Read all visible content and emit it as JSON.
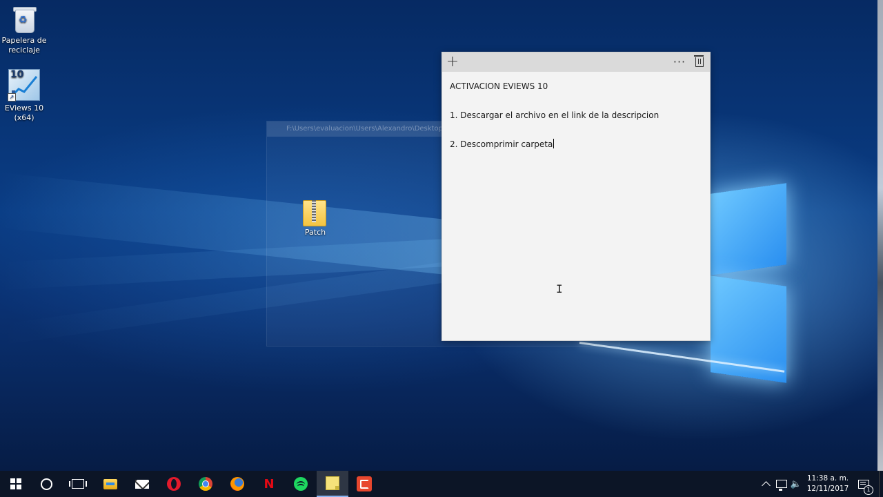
{
  "desktop": {
    "icons": [
      {
        "label": "Papelera de reciclaje",
        "icon": "recycle-bin-icon"
      },
      {
        "label": "EViews 10 (x64)",
        "badge": "10",
        "icon": "eviews-icon"
      },
      {
        "label": "Patch",
        "icon": "zip-folder-icon"
      }
    ],
    "ghost_window_title": "F:\\Users\\evaluacion\\Users\\Alexandro\\Desktop\\Patch.zip"
  },
  "sticky_note": {
    "title": "ACTIVACION EVIEWS 10",
    "lines": [
      "1. Descargar el archivo en el link de la descripcion",
      "2. Descomprimir carpeta"
    ],
    "add_glyph": "+",
    "more_glyph": "···"
  },
  "taskbar": {
    "apps": [
      {
        "name": "start",
        "icon": "windows-start-icon"
      },
      {
        "name": "cortana",
        "icon": "cortana-icon"
      },
      {
        "name": "task-view",
        "icon": "task-view-icon"
      },
      {
        "name": "file-explorer",
        "icon": "folder-icon"
      },
      {
        "name": "mail",
        "icon": "mail-icon"
      },
      {
        "name": "opera",
        "icon": "opera-icon"
      },
      {
        "name": "chrome",
        "icon": "chrome-icon"
      },
      {
        "name": "firefox",
        "icon": "firefox-icon"
      },
      {
        "name": "netflix",
        "icon": "netflix-icon",
        "glyph": "N"
      },
      {
        "name": "spotify",
        "icon": "spotify-icon"
      },
      {
        "name": "sticky-notes",
        "icon": "sticky-notes-icon",
        "active": true
      },
      {
        "name": "camtasia",
        "icon": "camtasia-icon"
      }
    ],
    "clock": {
      "time": "11:38 a. m.",
      "date": "12/11/2017"
    },
    "notification_count": "1",
    "volume_glyph": "🔈"
  },
  "colors": {
    "taskbar": "#0c1526",
    "sticky_bg": "#f3f3f3",
    "sticky_bar": "#dadada",
    "accent": "#2a8ff0"
  }
}
